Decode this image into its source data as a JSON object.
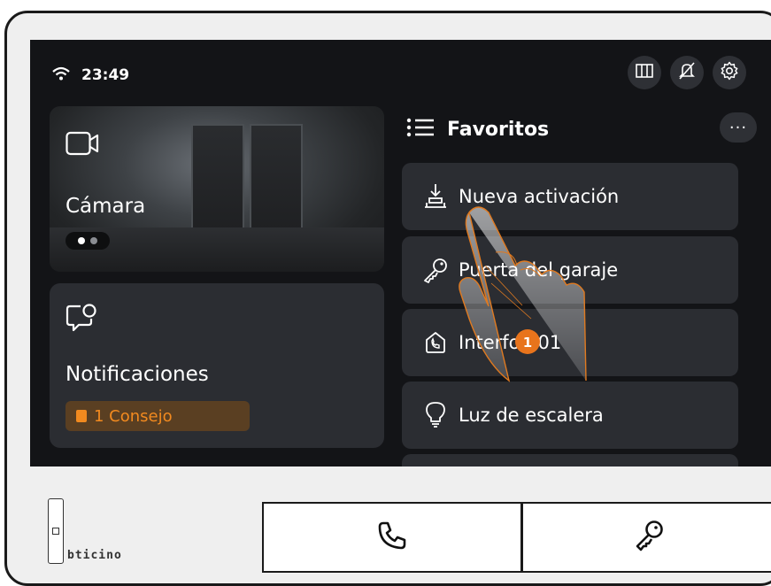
{
  "status": {
    "time": "23:49",
    "wifi_icon": "wifi-icon"
  },
  "top_buttons": [
    {
      "icon": "door-panel-icon"
    },
    {
      "icon": "bell-off-icon"
    },
    {
      "icon": "gear-icon"
    }
  ],
  "camera": {
    "label": "Cámara",
    "icon": "camera-icon"
  },
  "notifications": {
    "label": "Notificaciones",
    "tip": "1 Consejo",
    "icon": "chat-bubble-icon"
  },
  "favorites": {
    "title": "Favoritos",
    "more": "···",
    "items": [
      {
        "label": "Nueva activación",
        "icon": "activation-icon"
      },
      {
        "label": "Puerta del garaje",
        "icon": "key-icon"
      },
      {
        "label": "Interfon 01",
        "icon": "intercom-icon"
      },
      {
        "label": "Luz de escalera",
        "icon": "bulb-icon"
      }
    ]
  },
  "annotation": {
    "step": "1"
  },
  "hardware": {
    "brand": "bticino",
    "call_icon": "phone-icon",
    "door_icon": "key-icon"
  },
  "colors": {
    "accent": "#f28a1f",
    "screen_bg": "#131417",
    "card_bg": "#2b2d32"
  }
}
